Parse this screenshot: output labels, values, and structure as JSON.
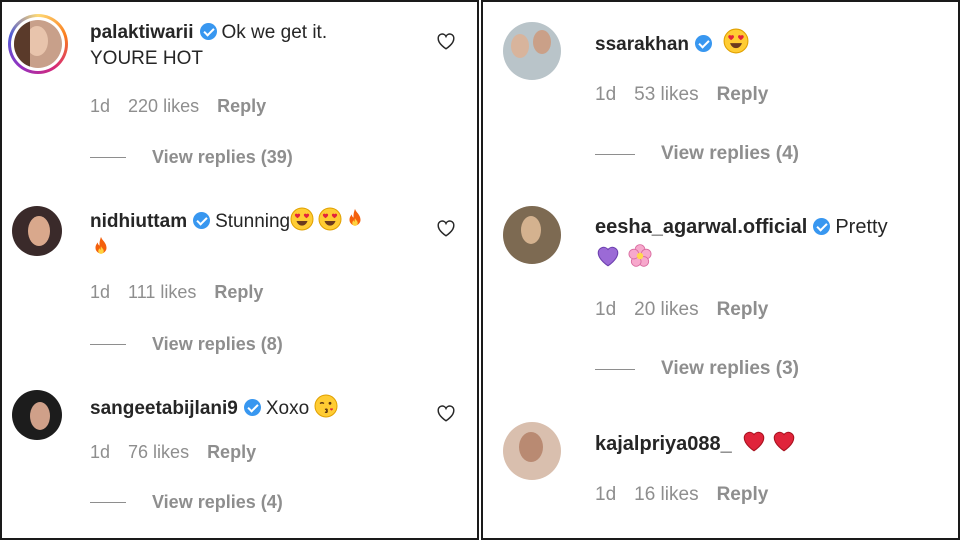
{
  "left_panel": {
    "comments": [
      {
        "username": "palaktiwarii",
        "text": "Ok we get it.",
        "text_line2": "YOURE HOT",
        "time": "1d",
        "likes": "220 likes",
        "reply": "Reply",
        "view_replies": "View replies (39)"
      },
      {
        "username": "nidhiuttam",
        "text": "Stunning",
        "time": "1d",
        "likes": "111 likes",
        "reply": "Reply",
        "view_replies": "View replies (8)"
      },
      {
        "username": "sangeetabijlani9",
        "text": "Xoxo",
        "time": "1d",
        "likes": "76 likes",
        "reply": "Reply",
        "view_replies": "View replies (4)"
      }
    ]
  },
  "right_panel": {
    "comments": [
      {
        "username": "ssarakhan",
        "text": "",
        "time": "1d",
        "likes": "53 likes",
        "reply": "Reply",
        "view_replies": "View replies (4)"
      },
      {
        "username": "eesha_agarwal.official",
        "text": "Pretty",
        "time": "1d",
        "likes": "20 likes",
        "reply": "Reply",
        "view_replies": "View replies (3)"
      },
      {
        "username": "kajalpriya088_",
        "text": "",
        "time": "1d",
        "likes": "16 likes",
        "reply": "Reply"
      }
    ]
  },
  "icons": {
    "verified": "verified-badge-icon",
    "like": "heart-outline-icon",
    "emoji_heart_eyes": "heart-eyes-emoji",
    "emoji_fire": "fire-emoji",
    "emoji_kiss": "kissing-winking-emoji",
    "emoji_purple_heart": "purple-heart-emoji",
    "emoji_blossom": "blossom-emoji",
    "emoji_red_heart": "red-heart-emoji"
  },
  "colors": {
    "verified": "#3897f0",
    "text": "#262626",
    "muted": "#8e8e8e"
  }
}
